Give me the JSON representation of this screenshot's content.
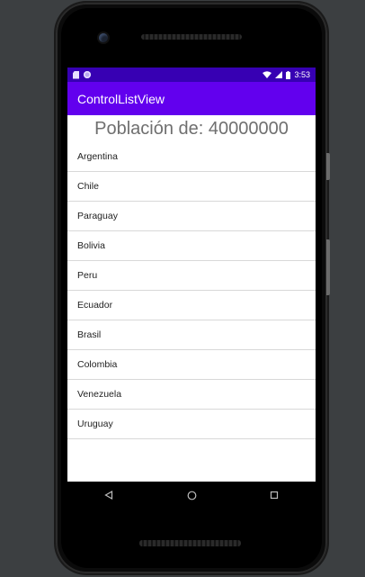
{
  "status_bar": {
    "time": "3:53",
    "icons": [
      "sd-card-icon",
      "circle-notification-icon",
      "wifi-icon",
      "cell-signal-icon",
      "battery-icon"
    ]
  },
  "app_bar": {
    "title": "ControlListView"
  },
  "population_label": "Población de: 40000000",
  "countries": [
    "Argentina",
    "Chile",
    "Paraguay",
    "Bolivia",
    "Peru",
    "Ecuador",
    "Brasil",
    "Colombia",
    "Venezuela",
    "Uruguay"
  ],
  "nav_bar": {
    "icons": [
      "back-icon",
      "home-icon",
      "recents-icon"
    ]
  },
  "colors": {
    "status_bar": "#3700b3",
    "app_bar": "#6200ee",
    "population_text": "#6f6f6f"
  }
}
